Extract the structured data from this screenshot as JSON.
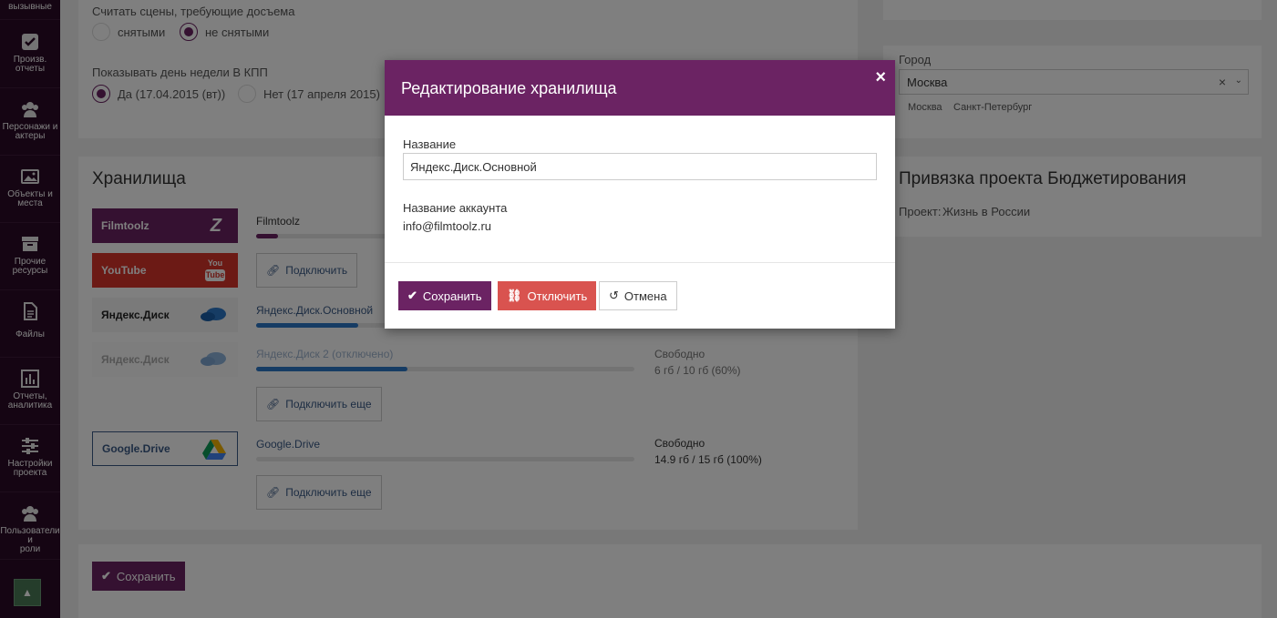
{
  "sidebar": {
    "top_label": "вызывные",
    "items": [
      {
        "label1": "Произв.",
        "label2": "отчеты",
        "icon": "check-square-icon"
      },
      {
        "label1": "Персонажи и",
        "label2": "актеры",
        "icon": "users-icon"
      },
      {
        "label1": "Объекты и",
        "label2": "места",
        "icon": "image-icon"
      },
      {
        "label1": "Прочие",
        "label2": "ресурсы",
        "icon": "archive-icon"
      },
      {
        "label1": "Файлы",
        "label2": "",
        "icon": "file-icon"
      },
      {
        "label1": "Отчеты,",
        "label2": "аналитика",
        "icon": "bar-chart-icon"
      },
      {
        "label1": "Настройки",
        "label2": "проекта",
        "icon": "sliders-icon"
      },
      {
        "label1": "Пользователи и",
        "label2": "роли",
        "icon": "users-icon"
      }
    ]
  },
  "settings": {
    "scenes_label": "Считать сцены, требующие досъема",
    "scenes_option1": "снятыми",
    "scenes_option2": "не снятыми",
    "weekday_label": "Показывать день недели В КПП",
    "weekday_option1": "Да (17.04.2015 (вт))",
    "weekday_option2": "Нет (17 апреля 2015)"
  },
  "city": {
    "label": "Город",
    "value": "Москва",
    "suggestions": [
      "Москва",
      "Санкт-Петербург"
    ]
  },
  "budget": {
    "title": "Привязка проекта Бюджетирования",
    "project_label": "Проект:",
    "project_value": "Жизнь в России"
  },
  "storages": {
    "title": "Хранилища",
    "filmtoolz": {
      "logo": "Filmtoolz",
      "name": "Filmtoolz",
      "progress": 0.12,
      "connect_label": "Подключить"
    },
    "youtube": {
      "logo": "YouTube",
      "logo_badge_top": "You",
      "logo_badge_bottom": "Tube"
    },
    "yandex1": {
      "logo": "Яндекс.Диск",
      "name": "Яндекс.Диск.Основной",
      "progress": 0.27
    },
    "yandex2": {
      "logo": "Яндекс.Диск",
      "name": "Яндекс.Диск 2 (отключено)",
      "progress": 0.4,
      "free_label": "Свободно",
      "free_value": "6 гб / 10 гб (60%)",
      "connect_more_label": "Подключить еще"
    },
    "gdrive": {
      "logo": "Google.Drive",
      "name": "Google.Drive",
      "free_label": "Свободно",
      "free_value": "14.9 гб / 15 гб (100%)",
      "connect_more_label": "Подключить еще"
    },
    "save_label": "Сохранить"
  },
  "modal": {
    "title": "Редактирование хранилища",
    "close": "×",
    "name_label": "Название",
    "name_value": "Яндекс.Диск.Основной",
    "account_label": "Название аккаунта",
    "account_value": "info@filmtoolz.ru",
    "save_label": "Сохранить",
    "disconnect_label": "Отключить",
    "cancel_label": "Отмена"
  },
  "colors": {
    "brand": "#6b2363",
    "danger": "#d9534f",
    "sidebar": "#2b0a27",
    "link": "#3a5a86"
  }
}
